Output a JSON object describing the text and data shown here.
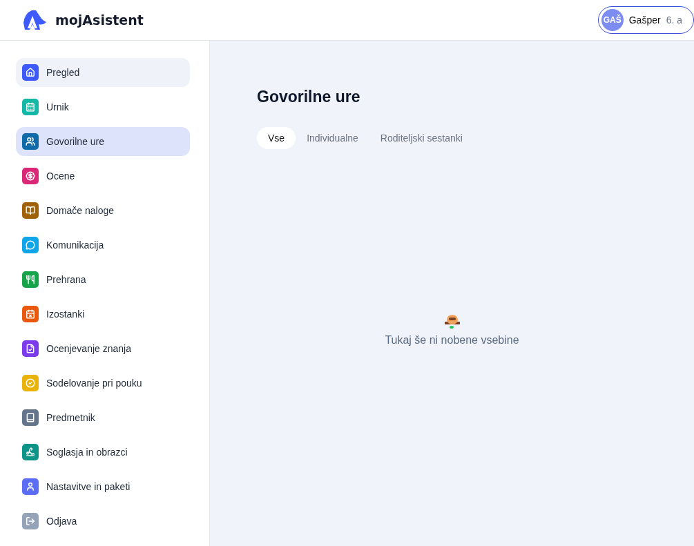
{
  "header": {
    "brand": "mojAsistent",
    "user": {
      "initials": "GAŠ",
      "name": "Gašper",
      "class": "6. a"
    }
  },
  "sidebar": {
    "items": [
      {
        "label": "Pregled",
        "selected": false,
        "hovered": true,
        "color": "#3d5afe"
      },
      {
        "label": "Urnik",
        "selected": false,
        "hovered": false,
        "color": "#14b8a6"
      },
      {
        "label": "Govorilne ure",
        "selected": true,
        "hovered": false,
        "color": "#0e6ba8"
      },
      {
        "label": "Ocene",
        "selected": false,
        "hovered": false,
        "color": "#db2777"
      },
      {
        "label": "Domače naloge",
        "selected": false,
        "hovered": false,
        "color": "#a16207"
      },
      {
        "label": "Komunikacija",
        "selected": false,
        "hovered": false,
        "color": "#0ea5e9"
      },
      {
        "label": "Prehrana",
        "selected": false,
        "hovered": false,
        "color": "#16a34a"
      },
      {
        "label": "Izostanki",
        "selected": false,
        "hovered": false,
        "color": "#ea580c"
      },
      {
        "label": "Ocenjevanje znanja",
        "selected": false,
        "hovered": false,
        "color": "#7c3aed"
      },
      {
        "label": "Sodelovanje pri pouku",
        "selected": false,
        "hovered": false,
        "color": "#eab308"
      },
      {
        "label": "Predmetnik",
        "selected": false,
        "hovered": false,
        "color": "#64748b"
      },
      {
        "label": "Soglasja in obrazci",
        "selected": false,
        "hovered": false,
        "color": "#0d9488"
      },
      {
        "label": "Nastavitve in paketi",
        "selected": false,
        "hovered": false,
        "color": "#5b6cf5"
      },
      {
        "label": "Odjava",
        "selected": false,
        "hovered": false,
        "color": "#94a3b8"
      }
    ]
  },
  "main": {
    "title": "Govorilne ure",
    "tabs": [
      {
        "label": "Vse",
        "selected": true
      },
      {
        "label": "Individualne",
        "selected": false
      },
      {
        "label": "Roditeljski sestanki",
        "selected": false
      }
    ],
    "empty_message": "Tukaj še ni nobene vsebine"
  }
}
